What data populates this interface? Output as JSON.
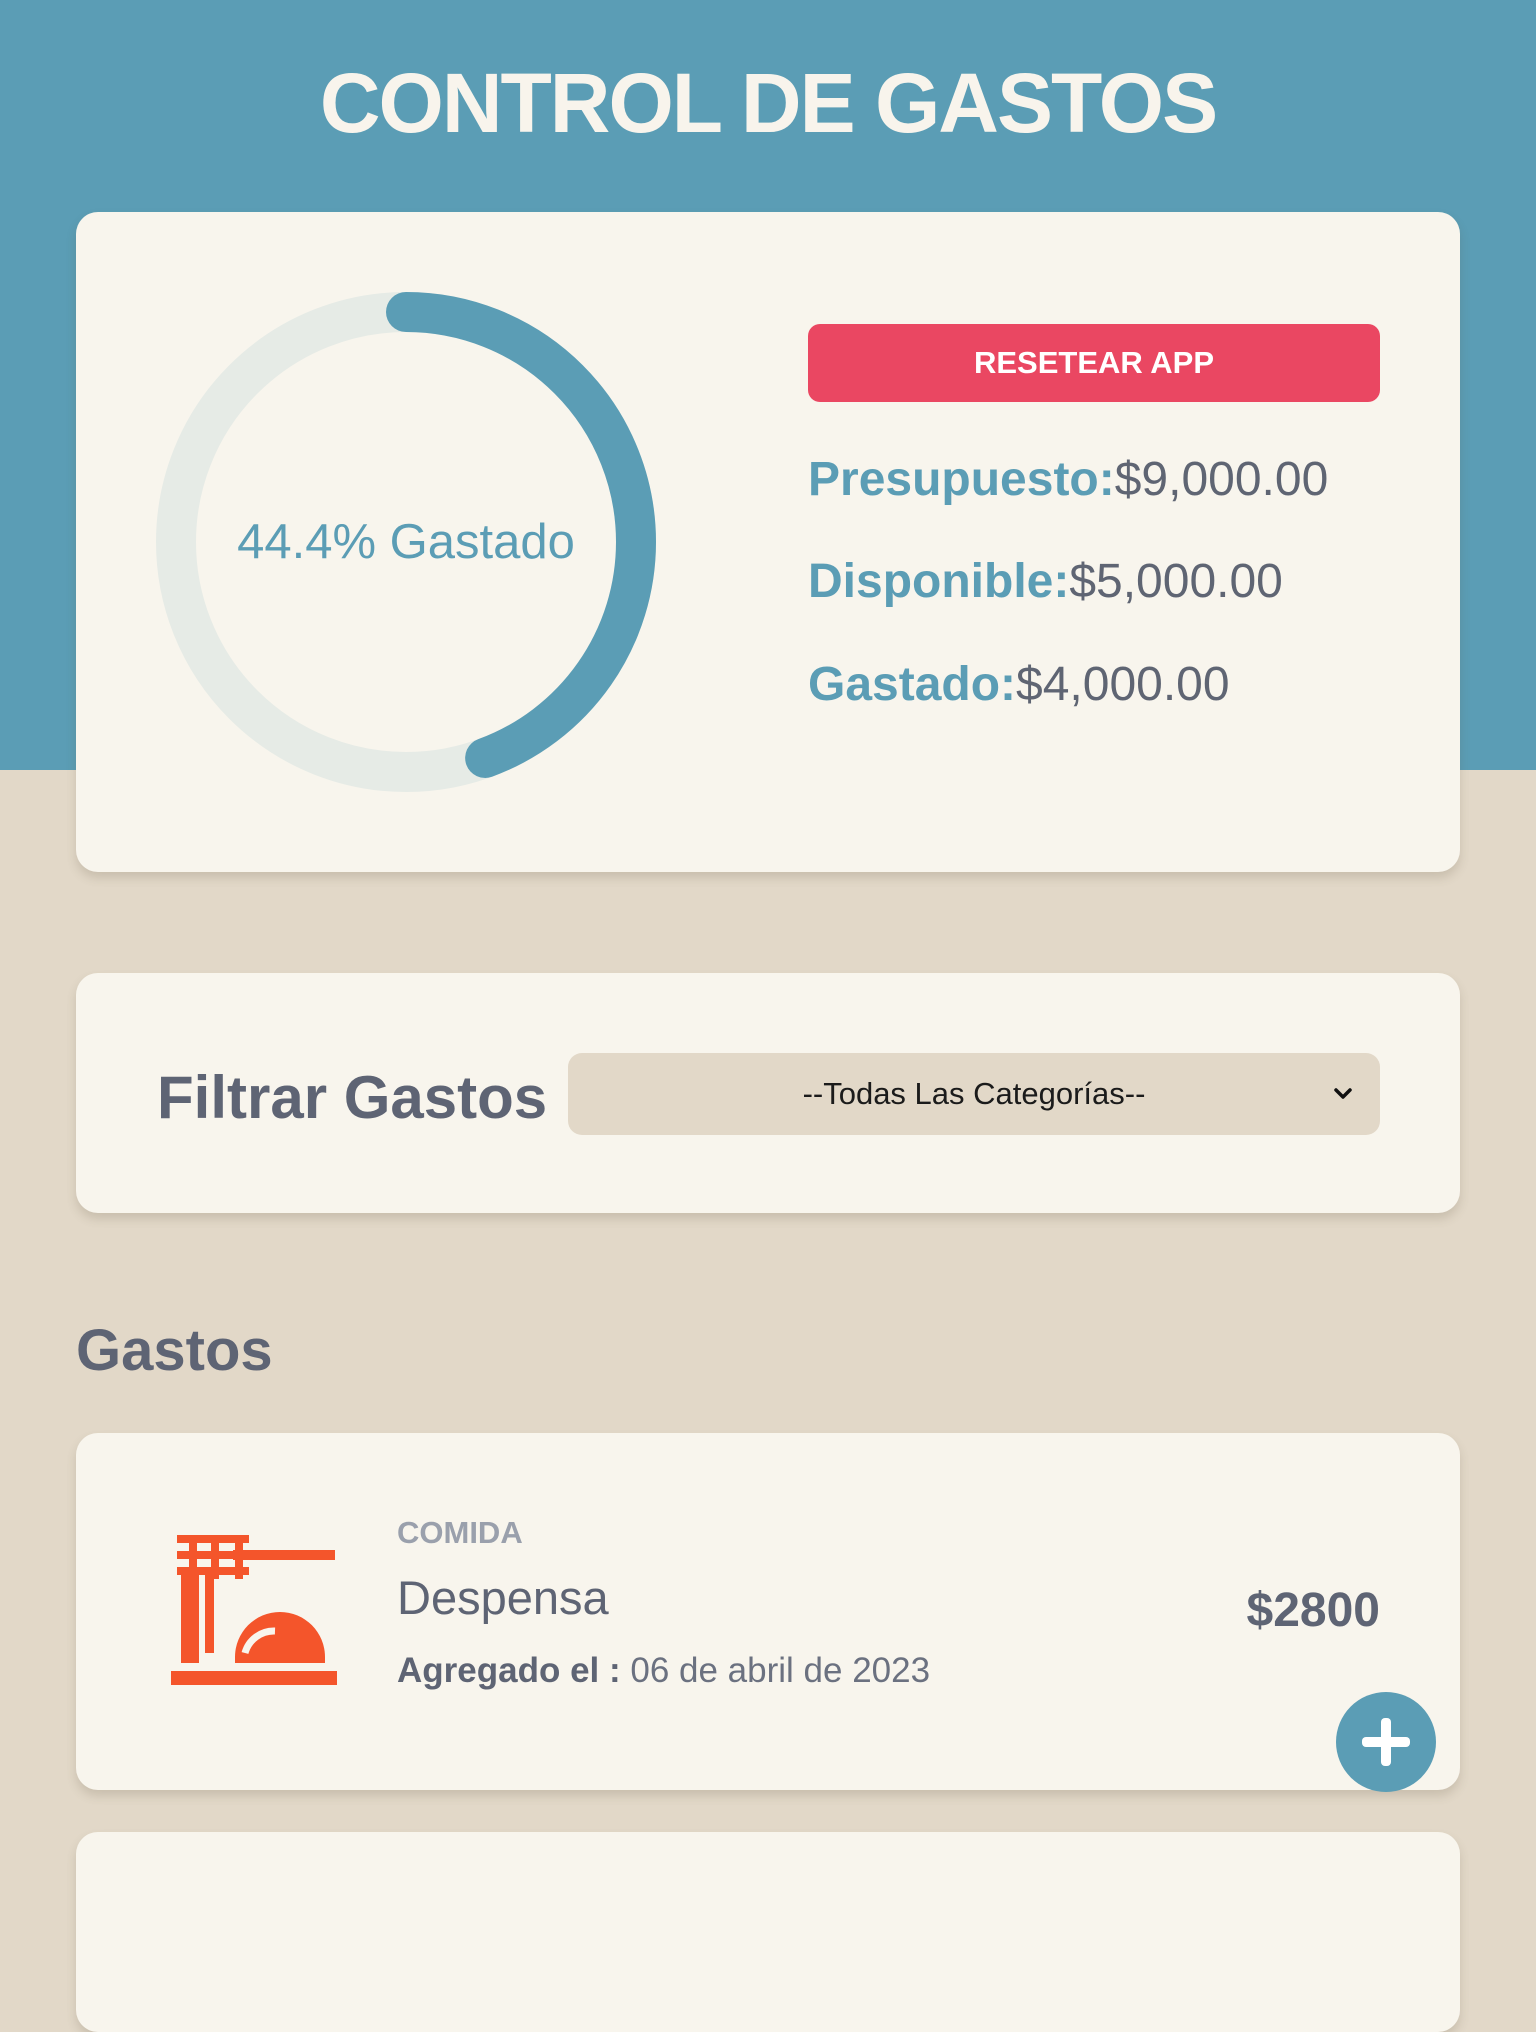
{
  "header": {
    "title": "CONTROL DE GASTOS"
  },
  "budget": {
    "progress_label": "44.4% Gastado",
    "percent_spent": 44.4,
    "reset_label": "RESETEAR APP",
    "presupuesto_label": "Presupuesto:",
    "presupuesto_value": "$9,000.00",
    "disponible_label": "Disponible:",
    "disponible_value": "$5,000.00",
    "gastado_label": "Gastado:",
    "gastado_value": "$4,000.00"
  },
  "filter": {
    "title": "Filtrar Gastos",
    "selected": "--Todas Las Categorías--"
  },
  "expenses": {
    "title": "Gastos",
    "items": [
      {
        "category": "COMIDA",
        "name": "Despensa",
        "date_label": "Agregado el :",
        "date_value": "06 de abril de 2023",
        "amount": "$2800",
        "icon": "food-icon"
      }
    ]
  },
  "colors": {
    "primary": "#5b9db5",
    "danger": "#ea4762",
    "background": "#e2d8c8",
    "card": "#f8f5ed",
    "food_icon": "#f4552b",
    "progress_track": "#e6ebe6"
  }
}
